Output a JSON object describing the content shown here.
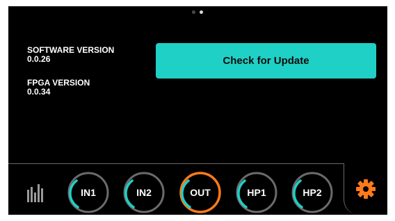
{
  "pager": {
    "dots": 2,
    "active_index": 1
  },
  "software": {
    "label": "SOFTWARE VERSION",
    "value": "0.0.26"
  },
  "fpga": {
    "label": "FPGA VERSION",
    "value": "0.0.34"
  },
  "update_button": {
    "label": "Check for Update"
  },
  "bottom_bar": {
    "meter_icon": "level-meter-icon",
    "settings_icon": "gear-icon",
    "knobs": [
      {
        "label": "IN1"
      },
      {
        "label": "IN2"
      },
      {
        "label": "OUT"
      },
      {
        "label": "HP1"
      },
      {
        "label": "HP2"
      }
    ]
  },
  "colors": {
    "background": "#000000",
    "accent_teal": "#1fd0c6",
    "accent_orange": "#ff7a1a",
    "ring_gray": "#6b6b6b",
    "text": "#ffffff"
  }
}
